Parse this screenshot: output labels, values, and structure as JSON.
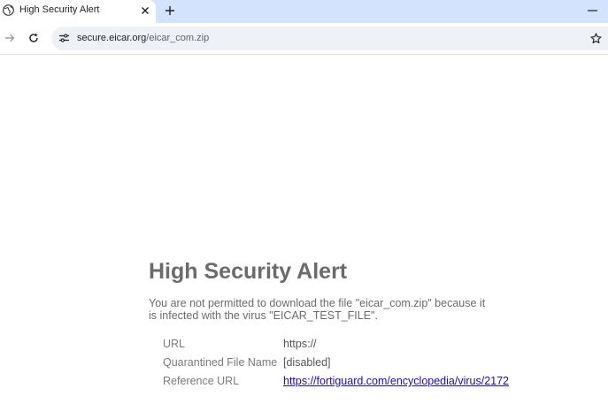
{
  "browser": {
    "tab": {
      "title": "High Security Alert",
      "favicon": "globe-icon"
    },
    "address_bar": {
      "host": "secure.eicar.org",
      "path": "/eicar_com.zip"
    },
    "icons": [
      "globe-icon",
      "close-icon",
      "plus-icon",
      "minimize-icon",
      "forward-arrow-icon",
      "reload-icon",
      "site-info-icon",
      "star-icon"
    ]
  },
  "page": {
    "title": "High Security Alert",
    "message": "You are not permitted to download the file \"eicar_com.zip\" because it is infected with the virus \"EICAR_TEST_FILE\".",
    "details": [
      {
        "label": "URL",
        "value": "https://"
      },
      {
        "label": "Quarantined File Name",
        "value": "[disabled]"
      },
      {
        "label": "Reference URL",
        "value": "https://fortiguard.com/encyclopedia/virus/2172"
      }
    ]
  },
  "colors": {
    "tabbar_bg": "#d3e3fd",
    "omnibox_bg": "#eef1f6",
    "title_text": "#6b6b6b",
    "link": "#1a0dab"
  }
}
